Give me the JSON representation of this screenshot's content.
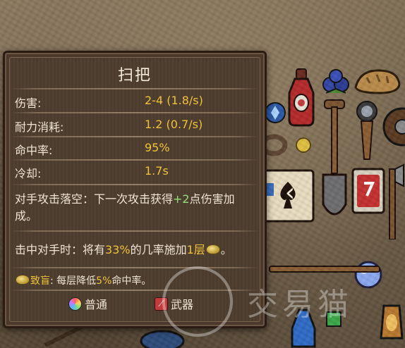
{
  "tooltip": {
    "title": "扫把",
    "stats": [
      {
        "label": "伤害:",
        "value": "2-4 (1.8/s)"
      },
      {
        "label": "耐力消耗:",
        "value": "1.2 (0.7/s)"
      },
      {
        "label": "命中率:",
        "value": "95%"
      },
      {
        "label": "冷却:",
        "value": "1.7s"
      }
    ],
    "miss_effect": {
      "pre": "对手攻击落空：下一次攻击获得",
      "bonus": "+2",
      "post": "点伤害加成。"
    },
    "hit_effect": {
      "pre": "击中对手时：将有",
      "chance": "33%",
      "mid": "的几率施加",
      "stacks": "1层",
      "post": "。"
    },
    "blind_desc": {
      "name": "致盲",
      "pre": ": 每层降低",
      "amount": "5%",
      "post": "命中率。"
    },
    "tags": [
      {
        "label": "普通",
        "icon": "rarity-common-icon"
      },
      {
        "label": "武器",
        "icon": "weapon-type-icon"
      }
    ]
  },
  "watermark": {
    "text": "交易猫"
  },
  "colors": {
    "panel_bg": "#4e3d2e",
    "text": "#efe5d2",
    "value_yellow": "#f0c23a",
    "bonus_green": "#8fe07a"
  }
}
